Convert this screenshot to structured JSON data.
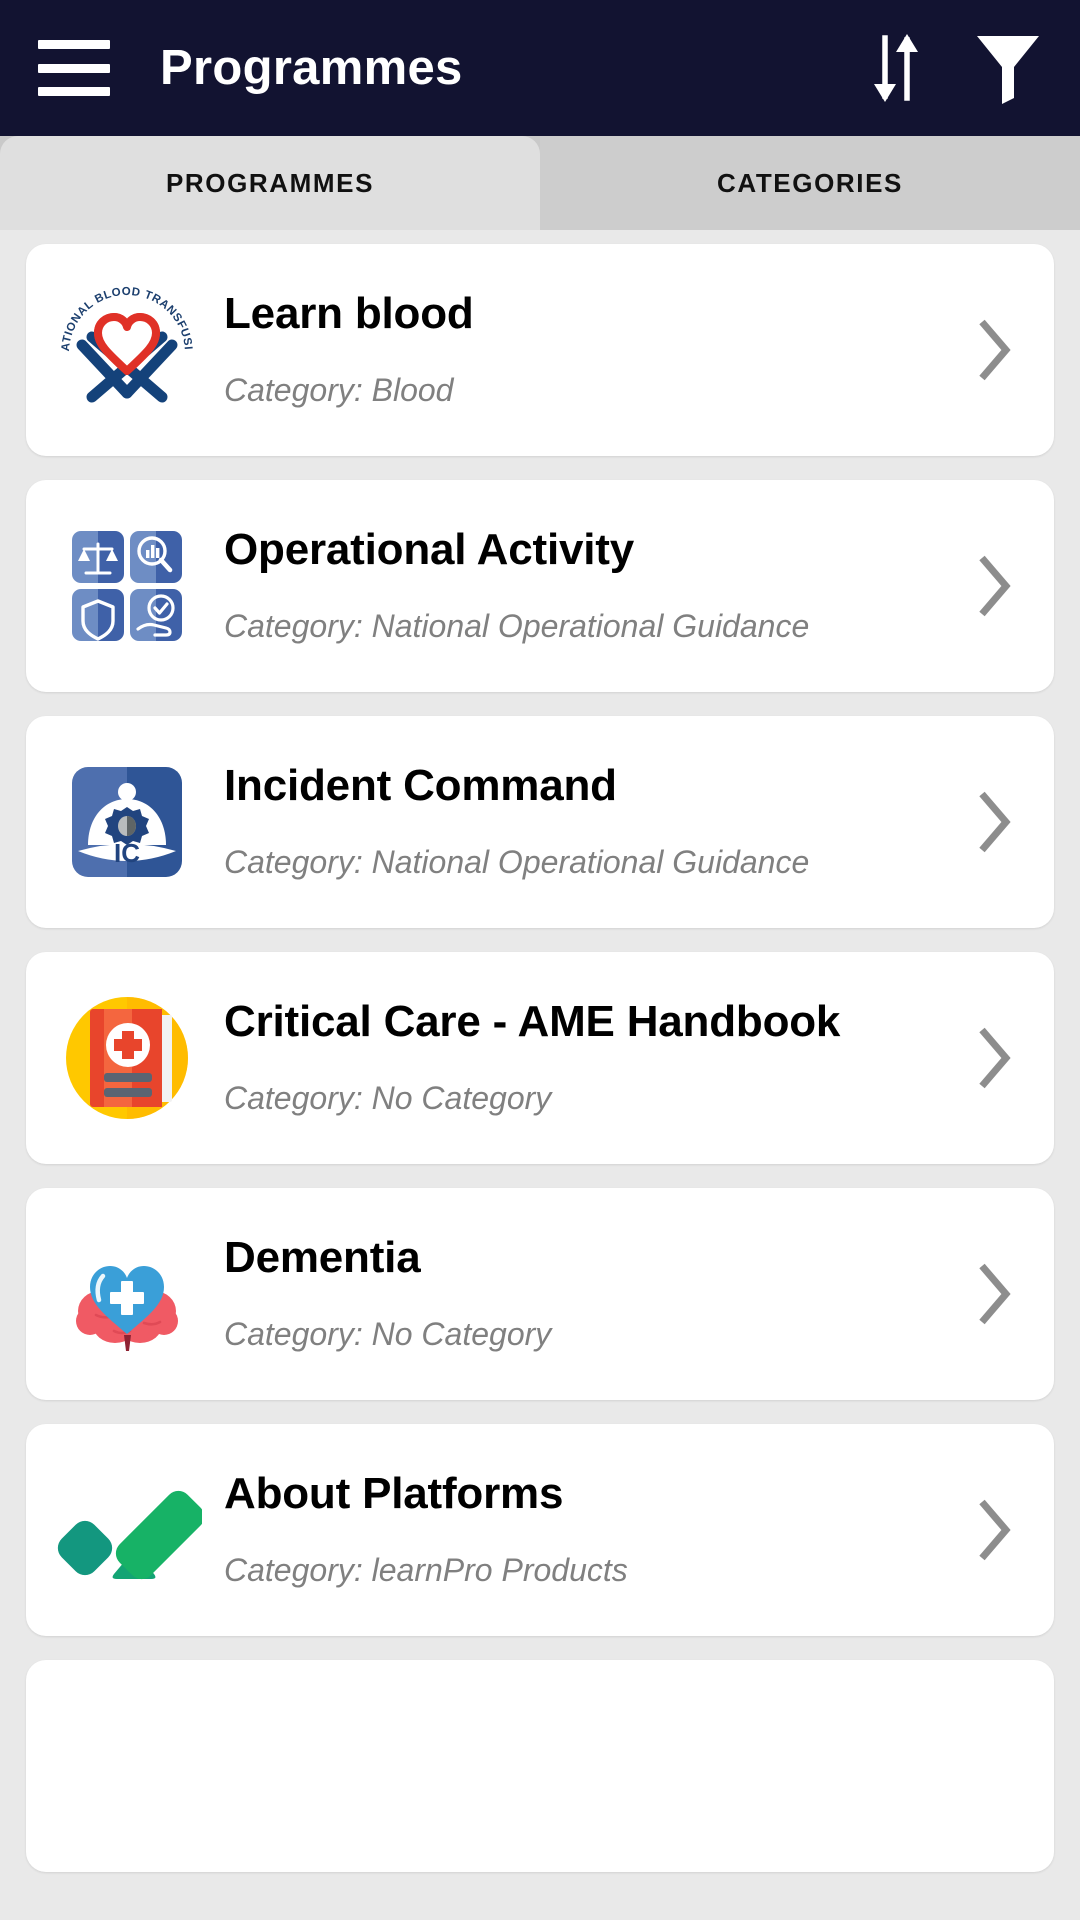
{
  "appbar": {
    "title": "Programmes",
    "menu_icon": "hamburger-menu-icon",
    "sort_icon": "sort-arrows-icon",
    "filter_icon": "filter-funnel-icon"
  },
  "tabs": [
    {
      "label": "PROGRAMMES",
      "active": true
    },
    {
      "label": "CATEGORIES",
      "active": false
    }
  ],
  "colors": {
    "appbar_bg": "#121331",
    "page_bg": "#e9e9e9",
    "tab_active_bg": "#dfdfdf",
    "tab_inactive_bg": "#cdcdcd",
    "card_bg": "#ffffff",
    "title_text": "#000000",
    "category_text": "#808080",
    "chevron": "#8d8d8d"
  },
  "programmes": [
    {
      "title": "Learn blood",
      "category": "Category: Blood",
      "icon": "snbts-blood-transfusion-logo-icon",
      "chevron": "chevron-right-icon"
    },
    {
      "title": "Operational Activity",
      "category": "Category: National Operational Guidance",
      "icon": "operational-activity-grid-icon",
      "chevron": "chevron-right-icon"
    },
    {
      "title": "Incident Command",
      "category": "Category: National Operational Guidance",
      "icon": "incident-command-helmet-icon",
      "chevron": "chevron-right-icon"
    },
    {
      "title": "Critical Care - AME Handbook",
      "category": "Category: No Category",
      "icon": "medical-handbook-icon",
      "chevron": "chevron-right-icon"
    },
    {
      "title": "Dementia",
      "category": "Category: No Category",
      "icon": "brain-heart-icon",
      "chevron": "chevron-right-icon"
    },
    {
      "title": "About Platforms",
      "category": "Category: learnPro Products",
      "icon": "learnpro-checkmark-icon",
      "chevron": "chevron-right-icon"
    }
  ]
}
